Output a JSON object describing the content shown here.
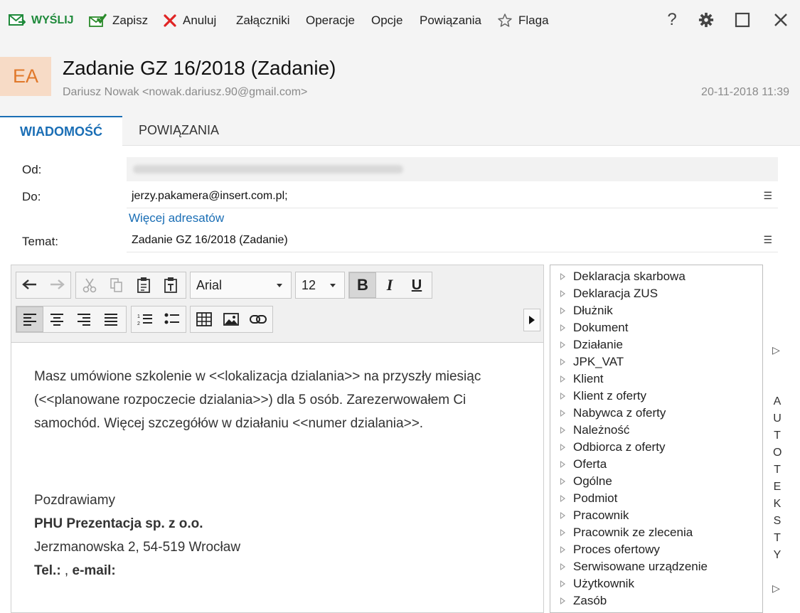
{
  "toolbar": {
    "send": "WYŚLIJ",
    "save": "Zapisz",
    "cancel": "Anuluj",
    "attachments": "Załączniki",
    "operations": "Operacje",
    "options": "Opcje",
    "links": "Powiązania",
    "flag": "Flaga",
    "help": "?"
  },
  "header": {
    "avatar": "EA",
    "title": "Zadanie GZ 16/2018 (Zadanie)",
    "sender": "Dariusz Nowak <nowak.dariusz.90@gmail.com>",
    "date": "20-11-2018 11:39"
  },
  "tabs": [
    {
      "label": "WIADOMOŚĆ",
      "active": true
    },
    {
      "label": "POWIĄZANIA",
      "active": false
    }
  ],
  "form": {
    "from_label": "Od:",
    "to_label": "Do:",
    "to_value": "jerzy.pakamera@insert.com.pl;",
    "more_recipients": "Więcej adresatów",
    "subject_label": "Temat:",
    "subject_value": "Zadanie GZ 16/2018 (Zadanie)"
  },
  "editor": {
    "font": "Arial",
    "size": "12",
    "bold": "B",
    "italic": "I",
    "underline": "U",
    "body": {
      "p1": "Masz umówione szkolenie w <<lokalizacja dzialania>> na przyszły miesiąc",
      "p2": "(<<planowane rozpoczecie dzialania>>) dla 5 osób. Zarezerwowałem Ci",
      "p3": "samochód. Więcej szczegółów w działaniu <<numer dzialania>>.",
      "greeting": "Pozdrawiamy",
      "company": "PHU Prezentacja sp. z o.o.",
      "address": "Jerzmanowska 2, 54-519 Wrocław",
      "tel_label": "Tel.:",
      "tel_sep": " , ",
      "email_label": "e-mail:"
    }
  },
  "autotext": {
    "items": [
      "Deklaracja skarbowa",
      "Deklaracja ZUS",
      "Dłużnik",
      "Dokument",
      "Działanie",
      "JPK_VAT",
      "Klient",
      "Klient z oferty",
      "Nabywca z oferty",
      "Należność",
      "Odbiorca z oferty",
      "Oferta",
      "Ogólne",
      "Podmiot",
      "Pracownik",
      "Pracownik ze zlecenia",
      "Proces ofertowy",
      "Serwisowane urządzenie",
      "Użytkownik",
      "Zasób"
    ],
    "side_label": [
      "A",
      "U",
      "T",
      "O",
      "T",
      "E",
      "K",
      "S",
      "T",
      "Y"
    ]
  },
  "colors": {
    "accent": "#1a6eb5",
    "send_green": "#1f8a3b",
    "cancel_red": "#e02424",
    "avatar_bg": "#f7dbc6",
    "avatar_fg": "#e0782a"
  }
}
